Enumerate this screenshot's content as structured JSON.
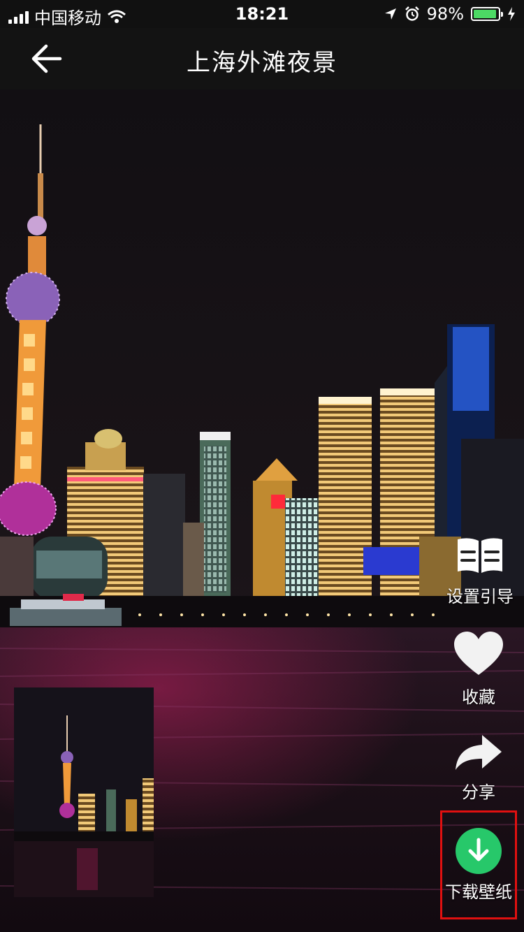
{
  "status_bar": {
    "carrier": "中国移动",
    "time": "18:21",
    "battery": "98%",
    "battery_color": "#4cd964"
  },
  "nav": {
    "title": "上海外滩夜景",
    "back_icon": "arrow-left-icon"
  },
  "actions": {
    "guide_label": "设置引导",
    "favorite_label": "收藏",
    "share_label": "分享",
    "download_label": "下载壁纸",
    "download_color": "#27c86a",
    "highlight_color": "#e01010"
  }
}
